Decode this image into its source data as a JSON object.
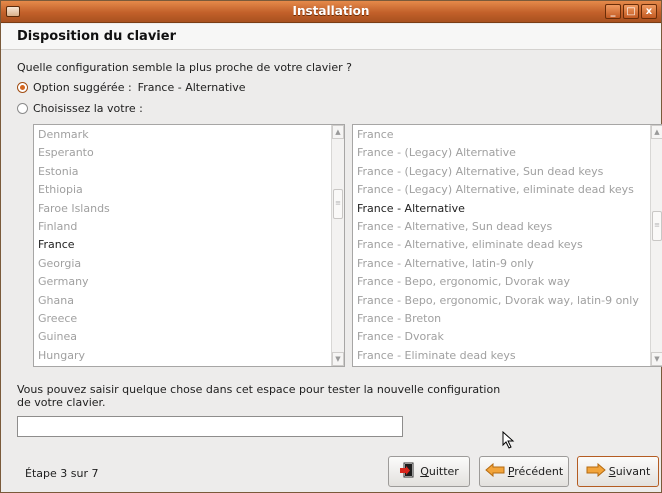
{
  "window": {
    "title": "Installation",
    "controls": [
      "_",
      "□",
      "x"
    ]
  },
  "header": {
    "title": "Disposition du clavier"
  },
  "question": "Quelle configuration semble la plus proche de votre clavier ?",
  "options": {
    "suggested": {
      "label": "Option suggérée :",
      "value": "France - Alternative",
      "checked": true
    },
    "choose": {
      "label": "Choisissez la votre :",
      "checked": false
    }
  },
  "countries": {
    "items": [
      "Denmark",
      "Esperanto",
      "Estonia",
      "Ethiopia",
      "Faroe Islands",
      "Finland",
      "France",
      "Georgia",
      "Germany",
      "Ghana",
      "Greece",
      "Guinea",
      "Hungary"
    ],
    "selected": "France"
  },
  "variants": {
    "items": [
      "France",
      "France - (Legacy) Alternative",
      "France - (Legacy) Alternative, Sun dead keys",
      "France - (Legacy) Alternative, eliminate dead keys",
      "France - Alternative",
      "France - Alternative, Sun dead keys",
      "France - Alternative, eliminate dead keys",
      "France - Alternative, latin-9 only",
      "France - Bepo, ergonomic, Dvorak way",
      "France - Bepo, ergonomic, Dvorak way, latin-9 only",
      "France - Breton",
      "France - Dvorak",
      "France - Eliminate dead keys"
    ],
    "selected": "France - Alternative"
  },
  "test": {
    "hint": "Vous pouvez saisir quelque chose dans cet espace pour tester la nouvelle configuration de votre clavier.",
    "value": ""
  },
  "footer": {
    "step": "Étape 3 sur 7",
    "quit": {
      "underlined": "Q",
      "rest": "uitter",
      "icon": "exit-door-icon"
    },
    "prev": {
      "underlined": "P",
      "rest": "récédent",
      "icon": "arrow-left-icon"
    },
    "next": {
      "underlined": "S",
      "rest": "uivant",
      "icon": "arrow-right-icon"
    }
  },
  "colors": {
    "accent": "#d4661f",
    "titlebar": "#c2602a",
    "arrow": "#f0a030"
  }
}
